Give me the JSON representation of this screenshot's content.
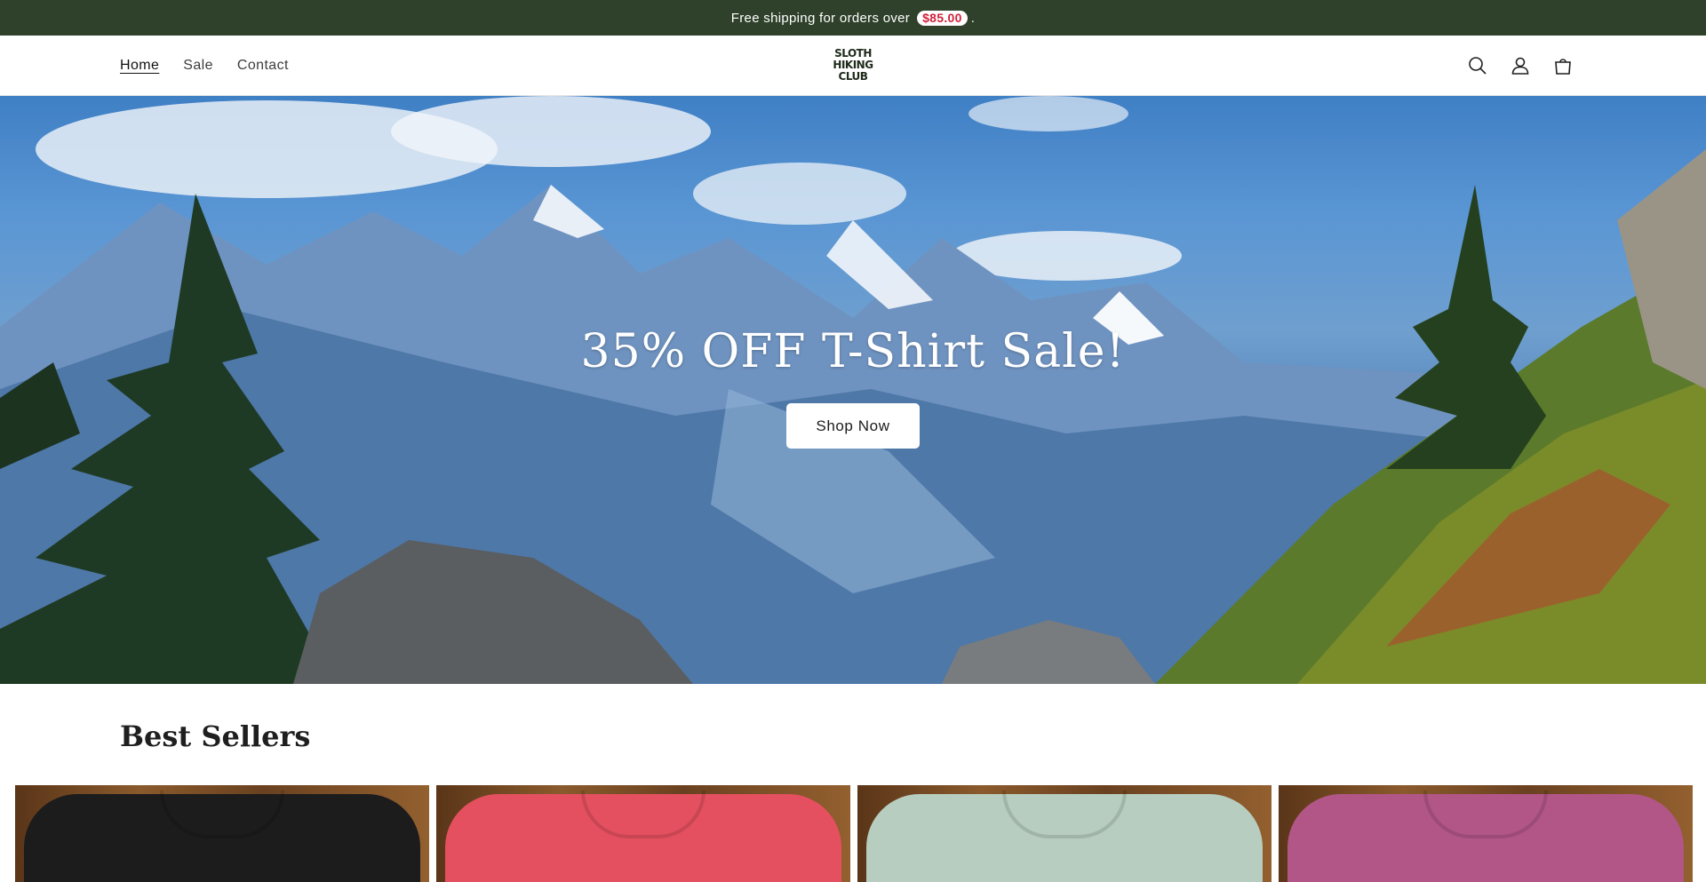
{
  "announcement": {
    "text": "Free shipping for orders over",
    "price": "$85.00",
    "suffix": "."
  },
  "nav": {
    "items": [
      {
        "label": "Home",
        "active": true
      },
      {
        "label": "Sale",
        "active": false
      },
      {
        "label": "Contact",
        "active": false
      }
    ]
  },
  "logo": {
    "line1": "SLOTH",
    "line2": "HIKING",
    "line3": "CLUB"
  },
  "header_icons": [
    "search-icon",
    "account-icon",
    "cart-icon"
  ],
  "hero": {
    "title": "35% OFF T-Shirt Sale!",
    "button_label": "Shop Now"
  },
  "best_sellers": {
    "title": "Best Sellers",
    "products": [
      {
        "color": "#1c1c1c"
      },
      {
        "color": "#e4505f"
      },
      {
        "color": "#b7cdbf"
      },
      {
        "color": "#b15687"
      }
    ]
  },
  "colors": {
    "announcement_bg": "#2f412a",
    "price_badge_text": "#d0223b",
    "button_bg": "#ffffff"
  }
}
